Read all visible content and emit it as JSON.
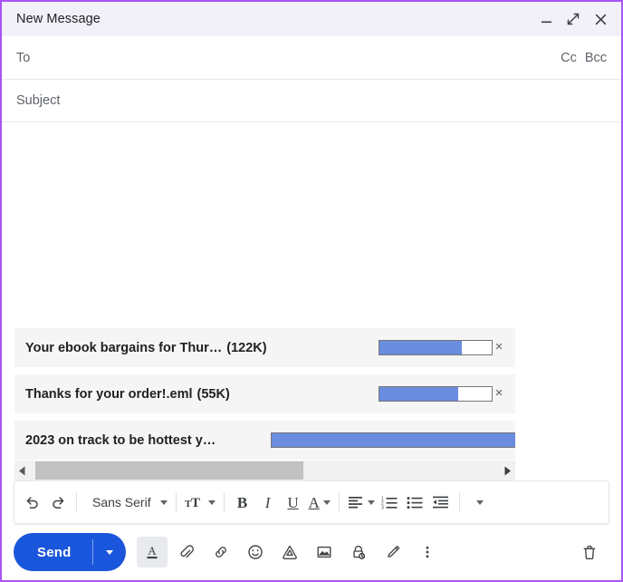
{
  "window": {
    "title": "New Message",
    "accent_border": "#a855f7",
    "header_bg": "#f2f1fa",
    "controls": [
      {
        "name": "minimize",
        "label": "Minimize"
      },
      {
        "name": "expand",
        "label": "Full screen"
      },
      {
        "name": "close",
        "label": "Save & close"
      }
    ]
  },
  "fields": {
    "to_placeholder": "To",
    "cc_label": "Cc",
    "bcc_label": "Bcc",
    "subject_placeholder": "Subject",
    "body_value": ""
  },
  "attachments": {
    "items": [
      {
        "name": "Your ebook bargains for Thur…",
        "size": "(122K)",
        "progress_percent": 73,
        "remove_label": "×"
      },
      {
        "name": "Thanks for your order!.eml",
        "size": "(55K)",
        "progress_percent": 70,
        "remove_label": "×"
      },
      {
        "name": "2023 on track to be hottest y…",
        "size": "",
        "progress_percent": 100,
        "remove_label": "×"
      }
    ],
    "scroll": {
      "left_arrow": "◀",
      "right_arrow": "▶",
      "thumb_position_percent": 0,
      "thumb_width_percent": 57
    },
    "progress_fill_color": "#6a8ddf"
  },
  "format_toolbar": {
    "undo_label": "Undo",
    "redo_label": "Redo",
    "font_name": "Sans Serif",
    "size_label": "Size",
    "bold_label": "B",
    "italic_label": "I",
    "underline_label": "U",
    "text_color_label": "A",
    "align_label": "Align",
    "numbered_list_label": "Numbered list",
    "bulleted_list_label": "Bulleted list",
    "indent_less_label": "Indent less",
    "more_label": "More formatting options"
  },
  "action_bar": {
    "send_label": "Send",
    "send_button_color": "#1a56db",
    "send_options_label": "More send options",
    "tools": [
      {
        "name": "formatting-options",
        "label": "Formatting options",
        "active": true
      },
      {
        "name": "attach-file",
        "label": "Attach files",
        "active": false
      },
      {
        "name": "insert-link",
        "label": "Insert link",
        "active": false
      },
      {
        "name": "insert-emoji",
        "label": "Insert emoji",
        "active": false
      },
      {
        "name": "insert-drive-file",
        "label": "Insert files using Drive",
        "active": false
      },
      {
        "name": "insert-photo",
        "label": "Insert photo",
        "active": false
      },
      {
        "name": "confidential-mode",
        "label": "Toggle confidential mode",
        "active": false
      },
      {
        "name": "insert-signature",
        "label": "Insert signature",
        "active": false
      },
      {
        "name": "more-options",
        "label": "More options",
        "active": false
      }
    ],
    "discard_label": "Discard draft"
  }
}
